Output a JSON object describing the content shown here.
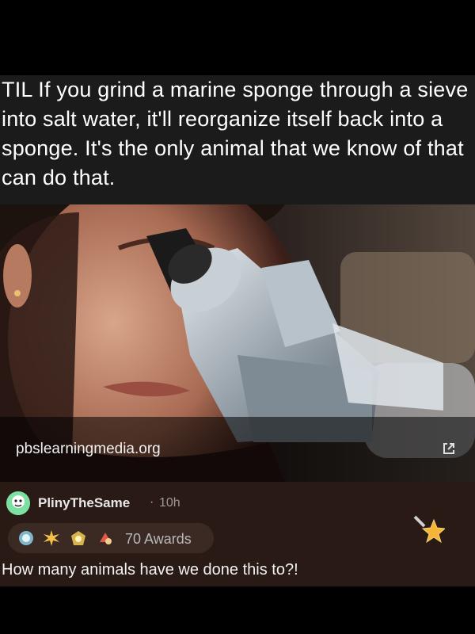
{
  "post": {
    "title": "TIL If you grind a marine sponge through a sieve into salt water, it'll reorganize itself back into a sponge. It's the only animal that we know of that can do that.",
    "link": {
      "domain": "pbslearningmedia.org",
      "icon": "external-link-icon"
    }
  },
  "comment": {
    "username": "PlinyTheSame",
    "separator": "·",
    "time": "10h",
    "awards_label": "70 Awards",
    "body": "How many animals have we done this to?!",
    "award_icons": [
      "silver-ring-icon",
      "starburst-icon",
      "gold-badge-icon",
      "helpful-icon"
    ],
    "give_award_icon": "star-award-icon"
  },
  "colors": {
    "background": "#000000",
    "post_bg": "#1b1b1b",
    "comment_bg": "#2a1a15",
    "text": "#ffffff",
    "muted": "#9a9a9a"
  }
}
